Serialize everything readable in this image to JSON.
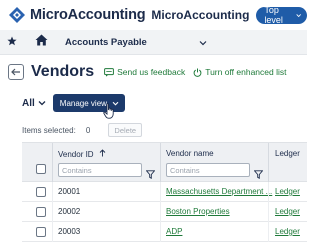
{
  "header": {
    "logo_text": "MicroAccounting",
    "company_name": "MicroAccounting",
    "level_label": "Top level",
    "brand_color": "#2a62b0"
  },
  "nav": {
    "title": "Accounts Payable"
  },
  "page": {
    "title": "Vendors",
    "feedback_label": "Send us feedback",
    "toggle_label": "Turn off enhanced list"
  },
  "toolbar": {
    "view_label": "All",
    "manage_view_label": "Manage view",
    "items_selected_label": "Items selected:",
    "items_selected_count": "0",
    "delete_label": "Delete"
  },
  "table": {
    "columns": {
      "vendor_id": "Vendor ID",
      "vendor_name": "Vendor name",
      "ledger": "Ledger"
    },
    "filter_placeholder": "Contains",
    "rows": [
      {
        "vendor_id": "20001",
        "vendor_name": "Massachusetts Department ...",
        "ledger": "Ledger"
      },
      {
        "vendor_id": "20002",
        "vendor_name": "Boston Properties",
        "ledger": "Ledger"
      },
      {
        "vendor_id": "20003",
        "vendor_name": "ADP",
        "ledger": "Ledger"
      }
    ]
  }
}
